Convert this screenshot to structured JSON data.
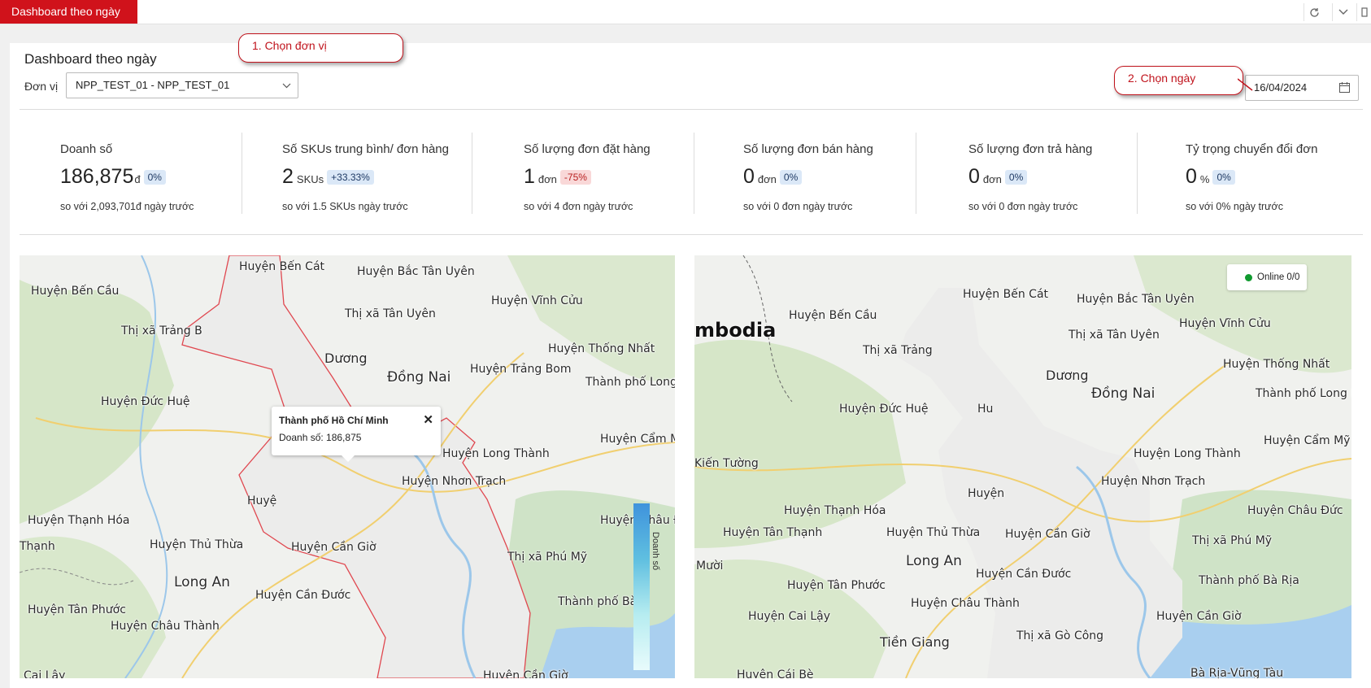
{
  "tabs": {
    "active": "Dashboard theo ngày"
  },
  "page": {
    "title": "Dashboard theo ngày"
  },
  "filter": {
    "unit_label": "Đơn vị",
    "unit_value": "NPP_TEST_01 - NPP_TEST_01",
    "date_value": "16/04/2024"
  },
  "callouts": {
    "step1": "1. Chọn đơn vị",
    "step2": "2. Chọn ngày"
  },
  "kpis": [
    {
      "title": "Doanh số",
      "value": "186,875",
      "unit": "đ",
      "change": "0%",
      "compare": "so với 2,093,701đ ngày trước"
    },
    {
      "title": "Số SKUs trung bình/ đơn hàng",
      "value": "2",
      "unit": "SKUs",
      "change": "+33.33%",
      "compare": "so với 1.5 SKUs ngày trước"
    },
    {
      "title": "Số lượng đơn đặt hàng",
      "value": "1",
      "unit": "đơn",
      "change": "-75%",
      "compare": "so với 4 đơn ngày trước"
    },
    {
      "title": "Số lượng đơn bán hàng",
      "value": "0",
      "unit": "đơn",
      "change": "0%",
      "compare": "so với 0 đơn ngày trước"
    },
    {
      "title": "Số lượng đơn trả hàng",
      "value": "0",
      "unit": "đơn",
      "change": "0%",
      "compare": "so với 0 đơn ngày trước"
    },
    {
      "title": "Tỷ trọng chuyển đổi đơn",
      "value": "0",
      "unit": "%",
      "change": "0%",
      "compare": "so với 0% ngày trước"
    }
  ],
  "map_left": {
    "popup": {
      "name": "Thành phố Hồ Chí Minh",
      "value": "Doanh số: 186,875"
    },
    "legend_label": "Doanh số",
    "labels": [
      "Huyện Bến Cát",
      "Huyện Bắc Tân Uyên",
      "Huyện Bến Cầu",
      "Huyện Vĩnh Cửu",
      "Thị xã Tân Uyên",
      "Thị xã Trảng B",
      "Dương",
      "Huyện Thống Nhất",
      "Đồng Nai",
      "Huyện Trảng Bom",
      "Thành phố Long",
      "Huyện Đức Huệ",
      "Huyện Cẩm M",
      "Huyện Long Thành",
      "Huyện Nhơn Trạch",
      "Huyệ",
      "Huyện Thạnh Hóa",
      "Huyện Châu Đ",
      "Thạnh",
      "Huyện Thủ Thừa",
      "Huyện Cần Giờ",
      "Thị xã Phú Mỹ",
      "Long An",
      "Huyện Cần Đước",
      "Huyện Tân Phước",
      "Thành phố Bà",
      "Huyện Châu Thành",
      "Cai Lậy",
      "Huyện Cần Giờ"
    ]
  },
  "map_right": {
    "online": "Online 0/0",
    "labels": [
      "Huyện Bến Cát",
      "Huyện Bắc Tân Uyên",
      "mbodia",
      "Huyện Bến Cầu",
      "Huyện Vĩnh Cửu",
      "Thị xã Tân Uyên",
      "Thị xã Trảng",
      "Huyện Thống Nhất",
      "Dương",
      "Đồng Nai",
      "Thành phố Long K",
      "Huyện Đức Huệ",
      "Hu",
      "Huyện Cẩm Mỹ",
      "Kiến Tường",
      "Huyện Long Thành",
      "Huyện Nhơn Trạch",
      "Huyện",
      "Huyện Thạnh Hóa",
      "Huyện Châu Đức",
      "Huyện Tân Thạnh",
      "Huyện Thủ Thừa",
      "Huyện Cần Giờ",
      "Thị xã Phú Mỹ",
      "Long An",
      "Mười",
      "Huyện Cần Đước",
      "Thành phố Bà Rịa",
      "Huyện Tân Phước",
      "Huyện Châu Thành",
      "Huyện Cai Lậy",
      "Huyện Cần Giờ",
      "Tiền Giang",
      "Thị xã Gò Công",
      "Huyện Cái Bè",
      "Bà Rịa-Vũng Tàu"
    ]
  }
}
